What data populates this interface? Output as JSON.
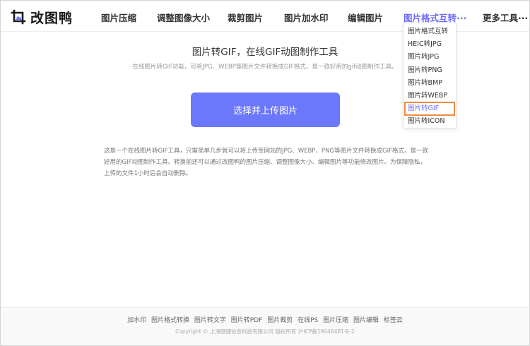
{
  "brand": {
    "name": "改图鸭",
    "accent": "#6b78fb"
  },
  "nav": {
    "items": [
      {
        "label": "图片压缩"
      },
      {
        "label": "调整图像大小"
      },
      {
        "label": "裁剪图片"
      },
      {
        "label": "图片加水印"
      },
      {
        "label": "编辑图片"
      },
      {
        "label": "图片格式互转···"
      },
      {
        "label": "更多工具···"
      }
    ]
  },
  "dropdown": {
    "items": [
      {
        "label": "图片格式互转"
      },
      {
        "label": "HEIC转JPG"
      },
      {
        "label": "图片转JPG"
      },
      {
        "label": "图片转PNG"
      },
      {
        "label": "图片转BMP"
      },
      {
        "label": "图片转WEBP"
      },
      {
        "label": "图片转GIF"
      },
      {
        "label": "图片转ICON"
      }
    ],
    "selected_index": 6,
    "highlight_color": "#f08a3c"
  },
  "main": {
    "title": "图片转GIF，在线GIF动图制作工具",
    "subtitle": "在线图片转GIF功能，可将JPG、WEBP等图片文件转换成GIF格式，是一款好用的gif动图制作工具。",
    "upload_label": "选择并上传图片",
    "description": [
      "这是一个在线图片转GIF工具，只需简单几步就可以将上传至网站的JPG、WEBP、PNG等图片文件转换成GIF格式，是一款",
      "好用的GIF动图制作工具。转换前还可以通过改图鸭的图片压缩、调整图像大小、编辑图片等功能修改图片。为保障隐私，",
      "上传的文件1小时后会自动删除。"
    ]
  },
  "footer": {
    "links": [
      "加水印",
      "图片格式转换",
      "图片转文字",
      "图片转PDF",
      "图片裁剪",
      "在线PS",
      "图片压缩",
      "图片编辑",
      "标签云"
    ],
    "copyright": "Copyright © 上海颐捷信息科技有限公司 版权所有 沪ICP备19046481号-2"
  }
}
